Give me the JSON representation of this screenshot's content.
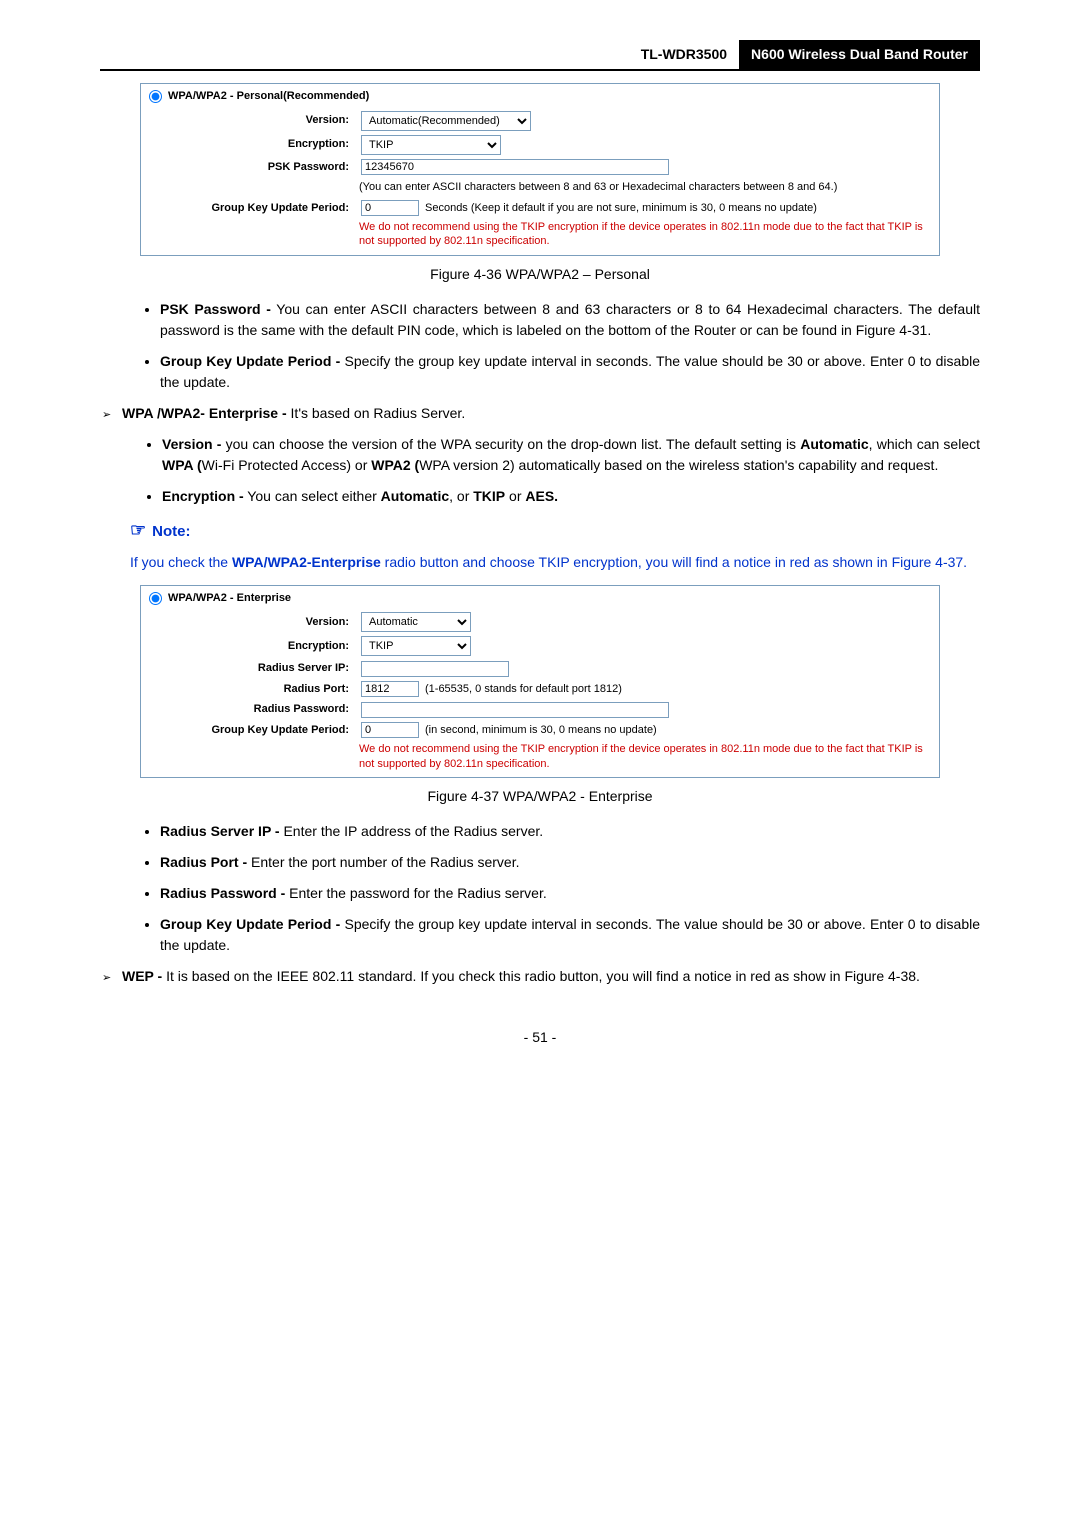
{
  "header": {
    "model": "TL-WDR3500",
    "product": "N600 Wireless Dual Band Router"
  },
  "panel1": {
    "title": "WPA/WPA2 - Personal(Recommended)",
    "rows": {
      "version_label": "Version:",
      "version_value": "Automatic(Recommended)",
      "encryption_label": "Encryption:",
      "encryption_value": "TKIP",
      "psk_label": "PSK Password:",
      "psk_value": "12345670",
      "psk_hint": "(You can enter ASCII characters between 8 and 63 or Hexadecimal characters between 8 and 64.)",
      "gkup_label": "Group Key Update Period:",
      "gkup_value": "0",
      "gkup_hint": "Seconds (Keep it default if you are not sure, minimum is 30, 0 means no update)"
    },
    "warn": "We do not recommend using the TKIP encryption if the device operates in 802.11n mode due to the fact that TKIP is not supported by 802.11n specification."
  },
  "fig1": "Figure 4-36 WPA/WPA2 – Personal",
  "body": {
    "psk_title": "PSK Password -",
    "psk_text": " You can enter ASCII characters between 8 and 63 characters or 8 to 64 Hexadecimal characters. The default password is the same with the default PIN code, which is labeled on the bottom of the Router or can be found in Figure 4-31.",
    "gkup_title": "Group Key Update Period -",
    "gkup_text": " Specify the group key update interval in seconds. The value should be 30 or above. Enter 0 to disable the update.",
    "wpa_ent_title": "WPA /WPA2- Enterprise -",
    "wpa_ent_text": " It's based on Radius Server.",
    "version_title": "Version  -",
    "version_text": " you can choose the version of the WPA security on the drop-down list. The default setting is ",
    "version_auto": "Automatic",
    "version_text2": ", which can select ",
    "version_wpa": " WPA (",
    "version_text3": "Wi-Fi Protected Access) or",
    "version_wpa2": " WPA2 (",
    "version_text4": "WPA version 2) automatically based on the wireless station's capability and request.",
    "enc_title": "Encryption -",
    "enc_text": "  You can select either ",
    "enc_auto": "Automatic",
    "enc_or": ", or ",
    "enc_tkip": "TKIP",
    "enc_or2": " or ",
    "enc_aes": "AES."
  },
  "note": {
    "label": "Note:",
    "text1": "If you check the ",
    "bold": "WPA/WPA2-Enterprise",
    "text2": " radio button and choose TKIP encryption, you will find a notice in red as shown in Figure 4-37."
  },
  "panel2": {
    "title": "WPA/WPA2 - Enterprise",
    "rows": {
      "version_label": "Version:",
      "version_value": "Automatic",
      "encryption_label": "Encryption:",
      "encryption_value": "TKIP",
      "rsip_label": "Radius Server IP:",
      "rsip_value": "",
      "rport_label": "Radius Port:",
      "rport_value": "1812",
      "rport_hint": "(1-65535, 0 stands for default port 1812)",
      "rpwd_label": "Radius Password:",
      "rpwd_value": "",
      "gkup_label": "Group Key Update Period:",
      "gkup_value": "0",
      "gkup_hint": "(in second, minimum is 30, 0 means no update)"
    },
    "warn": "We do not recommend using the TKIP encryption if the device operates in 802.11n mode due to the fact that TKIP is not supported by 802.11n specification."
  },
  "fig2": "Figure 4-37 WPA/WPA2 - Enterprise",
  "body2": {
    "rsip_title": "Radius Server IP -",
    "rsip_text": " Enter the IP address of the Radius server.",
    "rport_title": "Radius Port -",
    "rport_text": " Enter the port number of the Radius server.",
    "rpwd_title": "Radius Password -",
    "rpwd_text": " Enter the password for the Radius server.",
    "gkup_title": "Group Key Update Period -",
    "gkup_text": " Specify the group key update interval in seconds. The value should be 30 or above. Enter 0 to disable the update.",
    "wep_title": "WEP -",
    "wep_text": " It is based on the IEEE 802.11 standard. If you check this radio button, you will find a notice in red as show in Figure 4-38."
  },
  "pagenum": "- 51 -"
}
